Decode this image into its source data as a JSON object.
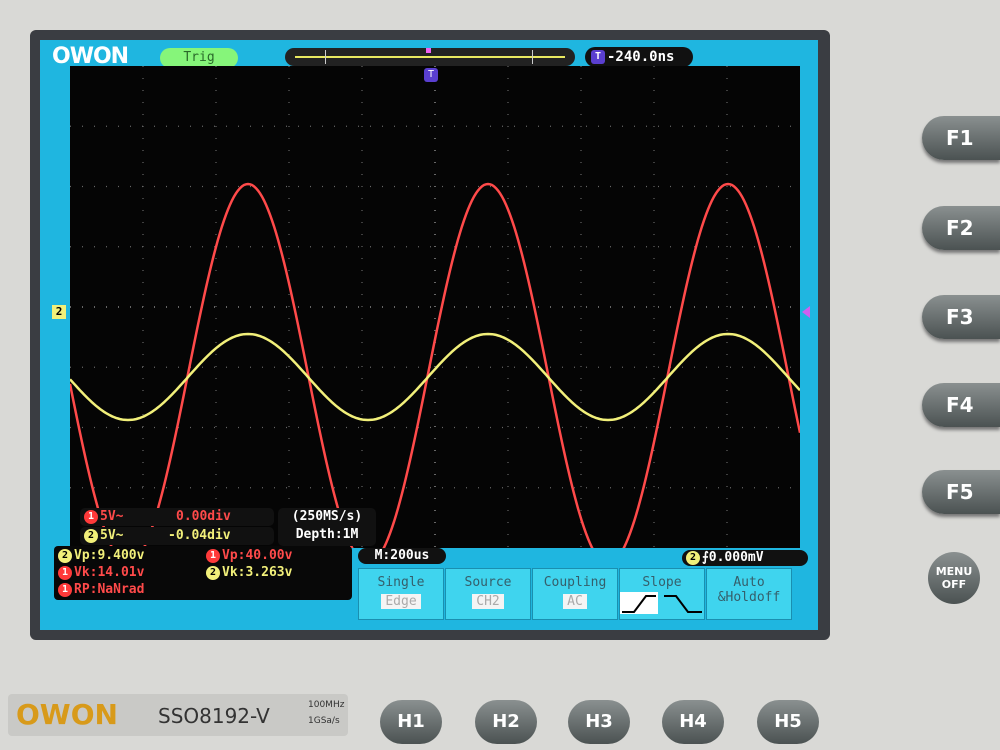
{
  "header": {
    "logo": "OWON",
    "trig_status": "Trig",
    "trigger_position": "-240.0ns",
    "t_marker": "T"
  },
  "channels": [
    {
      "num": "1",
      "scale": "5V~",
      "offset": "0.00div",
      "color": "#ff4a4a"
    },
    {
      "num": "2",
      "scale": "5V~",
      "offset": "-0.04div",
      "color": "#f2f07a"
    }
  ],
  "acquisition": {
    "sample_rate": "(250MS/s)",
    "depth": "Depth:1M"
  },
  "measurements": [
    {
      "ch": "2",
      "text": "Vp:9.400v"
    },
    {
      "ch": "1",
      "text": "Vp:40.00v"
    },
    {
      "ch": "1",
      "text": "Vk:14.01v"
    },
    {
      "ch": "2",
      "text": "Vk:3.263v"
    },
    {
      "ch": "1",
      "text": "RP:NaNrad"
    }
  ],
  "timebase": "M:200us",
  "trigger_info": {
    "ch": "2",
    "level": "0.000mV"
  },
  "menu": [
    {
      "label": "Single",
      "value": "Edge"
    },
    {
      "label": "Source",
      "value": "CH2"
    },
    {
      "label": "Coupling",
      "value": "AC"
    },
    {
      "label": "Slope",
      "value": ""
    },
    {
      "label": "Auto",
      "value": "&Holdoff"
    }
  ],
  "fkeys": [
    "F1",
    "F2",
    "F3",
    "F4",
    "F5"
  ],
  "hkeys": [
    "H1",
    "H2",
    "H3",
    "H4",
    "H5"
  ],
  "menu_off": {
    "line1": "MENU",
    "line2": "OFF"
  },
  "brand": {
    "logo": "OWON",
    "model": "SSO8192-V",
    "spec1": "100MHz",
    "spec2": "1GSa/s"
  }
}
